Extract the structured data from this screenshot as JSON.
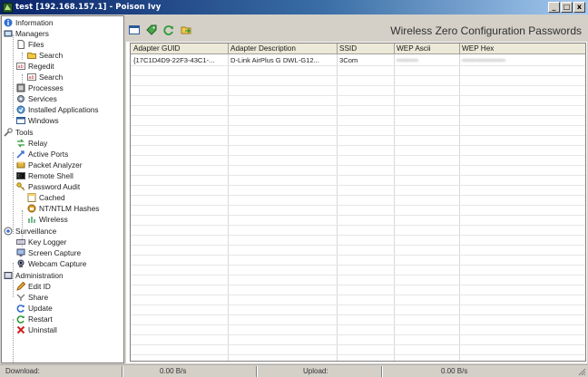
{
  "window": {
    "title": "test [192.168.157.1] - Poison Ivy",
    "controls": [
      "_",
      "□",
      "x"
    ]
  },
  "sidebar": {
    "items": [
      {
        "label": "Information",
        "icon": "info-icon"
      },
      {
        "label": "Managers",
        "icon": "managers-icon"
      },
      {
        "label": "Files",
        "icon": "file-icon"
      },
      {
        "label": "Search",
        "icon": "folder-search-icon"
      },
      {
        "label": "Regedit",
        "icon": "regedit-icon"
      },
      {
        "label": "Search",
        "icon": "regedit-search-icon"
      },
      {
        "label": "Processes",
        "icon": "processes-icon"
      },
      {
        "label": "Services",
        "icon": "services-icon"
      },
      {
        "label": "Installed Applications",
        "icon": "installed-apps-icon"
      },
      {
        "label": "Windows",
        "icon": "windows-icon"
      },
      {
        "label": "Tools",
        "icon": "tools-icon"
      },
      {
        "label": "Relay",
        "icon": "relay-icon"
      },
      {
        "label": "Active Ports",
        "icon": "active-ports-icon"
      },
      {
        "label": "Packet Analyzer",
        "icon": "packet-analyzer-icon"
      },
      {
        "label": "Remote Shell",
        "icon": "remote-shell-icon"
      },
      {
        "label": "Password Audit",
        "icon": "key-icon"
      },
      {
        "label": "Cached",
        "icon": "cached-icon"
      },
      {
        "label": "NT/NTLM Hashes",
        "icon": "hashes-icon"
      },
      {
        "label": "Wireless",
        "icon": "wireless-icon"
      },
      {
        "label": "Surveillance",
        "icon": "surveillance-icon"
      },
      {
        "label": "Key Logger",
        "icon": "keyboard-icon"
      },
      {
        "label": "Screen Capture",
        "icon": "screen-capture-icon"
      },
      {
        "label": "Webcam Capture",
        "icon": "webcam-icon"
      },
      {
        "label": "Administration",
        "icon": "administration-icon"
      },
      {
        "label": "Edit ID",
        "icon": "pencil-icon"
      },
      {
        "label": "Share",
        "icon": "share-icon"
      },
      {
        "label": "Update",
        "icon": "update-icon"
      },
      {
        "label": "Restart",
        "icon": "restart-icon"
      },
      {
        "label": "Uninstall",
        "icon": "uninstall-icon"
      }
    ]
  },
  "toolbar": {
    "icons": [
      "window-icon",
      "tag-icon",
      "refresh-icon",
      "export-icon"
    ]
  },
  "panel": {
    "title": "Wireless Zero Configuration Passwords"
  },
  "table": {
    "columns": [
      "Adapter GUID",
      "Adapter Description",
      "SSID",
      "WEP Ascii",
      "WEP Hex"
    ],
    "rows": [
      [
        "{17C1D4D9-22F3-43C1-...",
        "D-Link AirPlus G DWL-G12...",
        "3Com",
        "•••••••••",
        "••••••••••••••••••"
      ]
    ]
  },
  "status": {
    "download_label": "Download:",
    "download_value": "0.00 B/s",
    "upload_label": "Upload:",
    "upload_value": "0.00 B/s"
  },
  "colors": {
    "titlebar_start": "#0a246a",
    "titlebar_end": "#a6caf0",
    "chrome": "#d4d0c8"
  }
}
